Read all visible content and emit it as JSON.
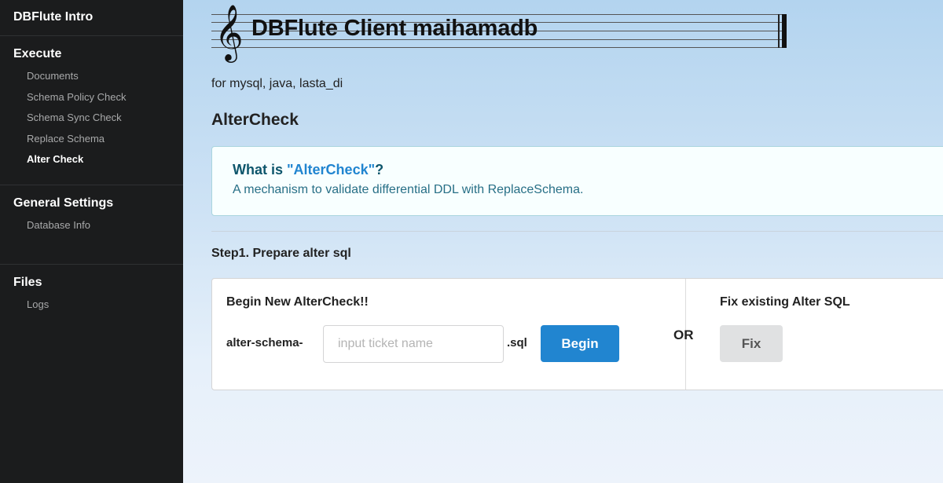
{
  "sidebar": {
    "brand": "DBFlute Intro",
    "sections": [
      {
        "header": "Execute",
        "items": [
          {
            "label": "Documents"
          },
          {
            "label": "Schema Policy Check"
          },
          {
            "label": "Schema Sync Check"
          },
          {
            "label": "Replace Schema"
          },
          {
            "label": "Alter Check"
          }
        ]
      },
      {
        "header": "General Settings",
        "items": [
          {
            "label": "Database Info"
          }
        ]
      },
      {
        "header": "Files",
        "items": [
          {
            "label": "Logs"
          }
        ]
      }
    ],
    "active_item": "Alter Check"
  },
  "header": {
    "clef_glyph": "𝄞",
    "title": "DBFlute Client maihamadb",
    "subtitle": "for mysql, java, lasta_di"
  },
  "page": {
    "heading": "AlterCheck",
    "info": {
      "title_prefix": "What is ",
      "title_highlight": "\"AlterCheck\"",
      "title_suffix": "?",
      "description": "A mechanism to validate differential DDL with ReplaceSchema."
    },
    "step1": {
      "heading": "Step1. Prepare alter sql",
      "begin": {
        "title": "Begin New AlterCheck!!",
        "prefix": "alter-schema-",
        "input_value": "",
        "input_placeholder": "input ticket name",
        "suffix": ".sql",
        "button_label": "Begin"
      },
      "or_label": "OR",
      "fix": {
        "title": "Fix existing Alter SQL",
        "button_label": "Fix"
      }
    }
  },
  "colors": {
    "sidebar_bg": "#1b1c1d",
    "primary_button": "#2185d0",
    "secondary_button": "#e0e1e2",
    "info_title": "#0e566c",
    "info_text": "#276f86"
  }
}
